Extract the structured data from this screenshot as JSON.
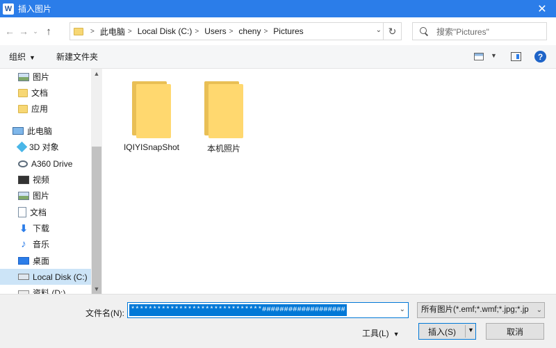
{
  "window": {
    "app_icon": "W",
    "title": "插入图片",
    "close": "✕"
  },
  "nav": {
    "back": "←",
    "forward": "→",
    "recent": "⌄",
    "up": "↑"
  },
  "address": {
    "crumbs": [
      "此电脑",
      "Local Disk (C:)",
      "Users",
      "cheny",
      "Pictures"
    ],
    "dropdown": "⌄",
    "refresh": "↻"
  },
  "search": {
    "placeholder": "搜索\"Pictures\""
  },
  "toolbar": {
    "organize": "组织",
    "organize_caret": "▼",
    "new_folder": "新建文件夹",
    "view_caret": "▼",
    "help": "?"
  },
  "sidebar": {
    "items": [
      {
        "label": "图片",
        "icon": "pictures-icon"
      },
      {
        "label": "文档",
        "icon": "folder-icon"
      },
      {
        "label": "应用",
        "icon": "folder-icon"
      },
      {
        "label": "此电脑",
        "icon": "computer-icon"
      },
      {
        "label": "3D 对象",
        "icon": "3d-objects-icon"
      },
      {
        "label": "A360 Drive",
        "icon": "cloud-drive-icon"
      },
      {
        "label": "视频",
        "icon": "video-icon"
      },
      {
        "label": "图片",
        "icon": "pictures-icon"
      },
      {
        "label": "文档",
        "icon": "document-icon"
      },
      {
        "label": "下载",
        "icon": "download-icon"
      },
      {
        "label": "音乐",
        "icon": "music-icon"
      },
      {
        "label": "桌面",
        "icon": "desktop-icon"
      },
      {
        "label": "Local Disk (C:)",
        "icon": "disk-icon",
        "selected": true
      },
      {
        "label": "资料 (D:)",
        "icon": "drive-icon"
      }
    ],
    "scroll_up": "▲",
    "scroll_down": "▼"
  },
  "files": [
    {
      "name": "IQIYISnapShot",
      "icon": "folder-icon"
    },
    {
      "name": "本机照片",
      "icon": "folder-icon"
    }
  ],
  "bottom": {
    "filename_label": "文件名(N):",
    "filename_value": "******************************###################",
    "filename_dropdown": "⌄",
    "filter": "所有图片(*.emf;*.wmf;*.jpg;*.jp",
    "filter_dropdown": "⌄",
    "tools": "工具(L)",
    "tools_caret": "▼",
    "insert": "插入(S)",
    "insert_caret": "▼",
    "cancel": "取消"
  },
  "colors": {
    "titlebar": "#2b7de9",
    "selection": "#cce4f7",
    "accent": "#0078d7"
  }
}
